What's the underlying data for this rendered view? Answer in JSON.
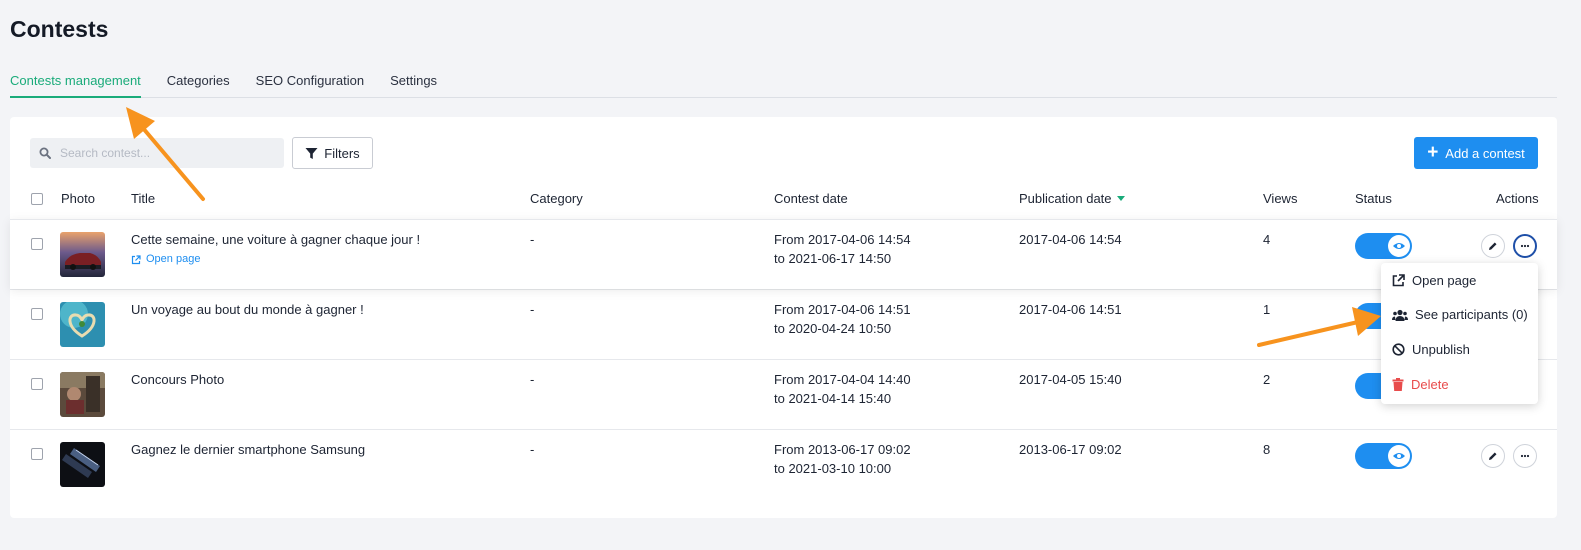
{
  "page": {
    "title": "Contests"
  },
  "tabs": [
    "Contests management",
    "Categories",
    "SEO Configuration",
    "Settings"
  ],
  "toolbar": {
    "search_placeholder": "Search contest...",
    "filters_label": "Filters",
    "add_label": "Add a contest"
  },
  "table": {
    "headers": {
      "photo": "Photo",
      "title": "Title",
      "category": "Category",
      "contest_date": "Contest date",
      "publication_date": "Publication date",
      "views": "Views",
      "status": "Status",
      "actions": "Actions"
    },
    "sorted_by": "publication_date",
    "rows": [
      {
        "title": "Cette semaine, une voiture à gagner chaque jour !",
        "link": "Open page",
        "category": "-",
        "date_from": "From 2017-04-06 14:54",
        "date_to": "to 2021-06-17 14:50",
        "publication": "2017-04-06 14:54",
        "views": "4",
        "published": true
      },
      {
        "title": "Un voyage au bout du monde à gagner !",
        "category": "-",
        "date_from": "From 2017-04-06 14:51",
        "date_to": "to 2020-04-24 10:50",
        "publication": "2017-04-06 14:51",
        "views": "1",
        "published": true
      },
      {
        "title": "Concours Photo",
        "category": "-",
        "date_from": "From 2017-04-04 14:40",
        "date_to": "to 2021-04-14 15:40",
        "publication": "2017-04-05 15:40",
        "views": "2",
        "published": true
      },
      {
        "title": "Gagnez le dernier smartphone Samsung",
        "category": "-",
        "date_from": "From 2013-06-17 09:02",
        "date_to": "to 2021-03-10 10:00",
        "publication": "2013-06-17 09:02",
        "views": "8",
        "published": true
      }
    ]
  },
  "menu": {
    "open_page": "Open page",
    "see_participants": "See participants (0)",
    "unpublish": "Unpublish",
    "delete": "Delete"
  },
  "colors": {
    "accent_green": "#1aab7a",
    "primary_blue": "#1e8ef0",
    "danger": "#e84c4c",
    "annotation_arrow": "#f7931e"
  },
  "icons": [
    "search-icon",
    "filter-icon",
    "plus-icon",
    "external-link-icon",
    "eye-icon",
    "pencil-icon",
    "more-icon",
    "users-icon",
    "ban-icon",
    "trash-icon",
    "arrow-annotation"
  ]
}
